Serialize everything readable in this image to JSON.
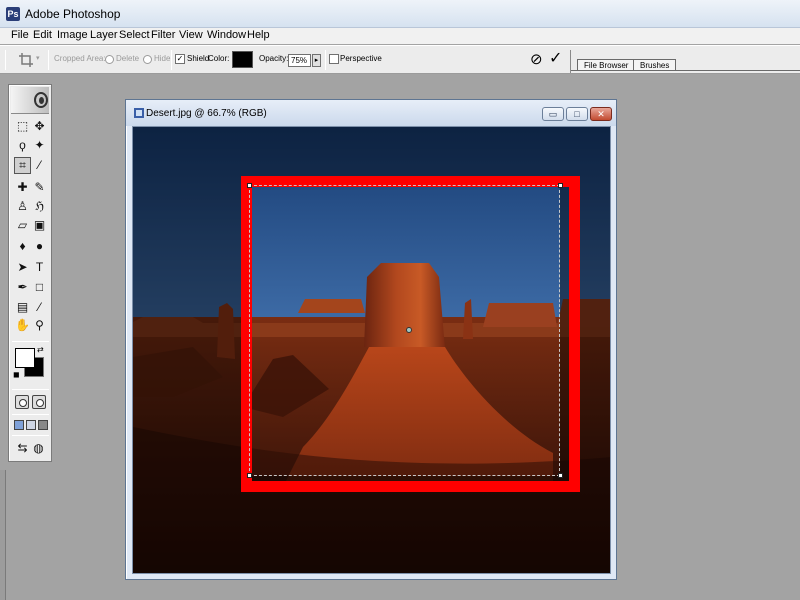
{
  "app": {
    "title": "Adobe Photoshop",
    "icon": "Ps"
  },
  "menu": [
    "File",
    "Edit",
    "Image",
    "Layer",
    "Select",
    "Filter",
    "View",
    "Window",
    "Help"
  ],
  "options_bar": {
    "cropped_area_label": "Cropped Area:",
    "delete_label": "Delete",
    "hide_label": "Hide",
    "shield_label": "Shield",
    "shield_checked": true,
    "color_label": "Color:",
    "shield_color": "#000000",
    "opacity_label": "Opacity:",
    "opacity_value": "75%",
    "perspective_label": "Perspective",
    "perspective_checked": false,
    "cancel_symbol": "⊘",
    "commit_symbol": "✓"
  },
  "palette_well": {
    "tabs": [
      "File Browser",
      "Brushes"
    ]
  },
  "toolbox": {
    "tools": [
      {
        "name": "rectangular-marquee-tool-icon",
        "glyph": "⬚"
      },
      {
        "name": "move-tool-icon",
        "glyph": "✥"
      },
      {
        "name": "lasso-tool-icon",
        "glyph": "ϙ"
      },
      {
        "name": "magic-wand-tool-icon",
        "glyph": "✦"
      },
      {
        "name": "crop-tool-icon",
        "glyph": "⌗",
        "active": true
      },
      {
        "name": "slice-tool-icon",
        "glyph": "⁄"
      },
      {
        "name": "healing-brush-tool-icon",
        "glyph": "✚"
      },
      {
        "name": "brush-tool-icon",
        "glyph": "✎"
      },
      {
        "name": "clone-stamp-tool-icon",
        "glyph": "♙"
      },
      {
        "name": "history-brush-tool-icon",
        "glyph": "ℌ"
      },
      {
        "name": "eraser-tool-icon",
        "glyph": "▱"
      },
      {
        "name": "gradient-tool-icon",
        "glyph": "▣"
      },
      {
        "name": "blur-tool-icon",
        "glyph": "♦"
      },
      {
        "name": "dodge-tool-icon",
        "glyph": "●"
      },
      {
        "name": "path-selection-tool-icon",
        "glyph": "➤"
      },
      {
        "name": "type-tool-icon",
        "glyph": "T"
      },
      {
        "name": "pen-tool-icon",
        "glyph": "✒"
      },
      {
        "name": "shape-tool-icon",
        "glyph": "□"
      },
      {
        "name": "notes-tool-icon",
        "glyph": "▤"
      },
      {
        "name": "eyedropper-tool-icon",
        "glyph": "⁄"
      },
      {
        "name": "hand-tool-icon",
        "glyph": "✋"
      },
      {
        "name": "zoom-tool-icon",
        "glyph": "⚲"
      }
    ],
    "foreground_color": "#ffffff",
    "background_color": "#000000"
  },
  "document": {
    "title": "Desert.jpg @ 66.7% (RGB)",
    "minimize_symbol": "▭",
    "maximize_symbol": "□",
    "close_symbol": "✕"
  },
  "colors": {
    "workspace": "#a3a3a3",
    "highlight_rect": "#ff0000"
  }
}
